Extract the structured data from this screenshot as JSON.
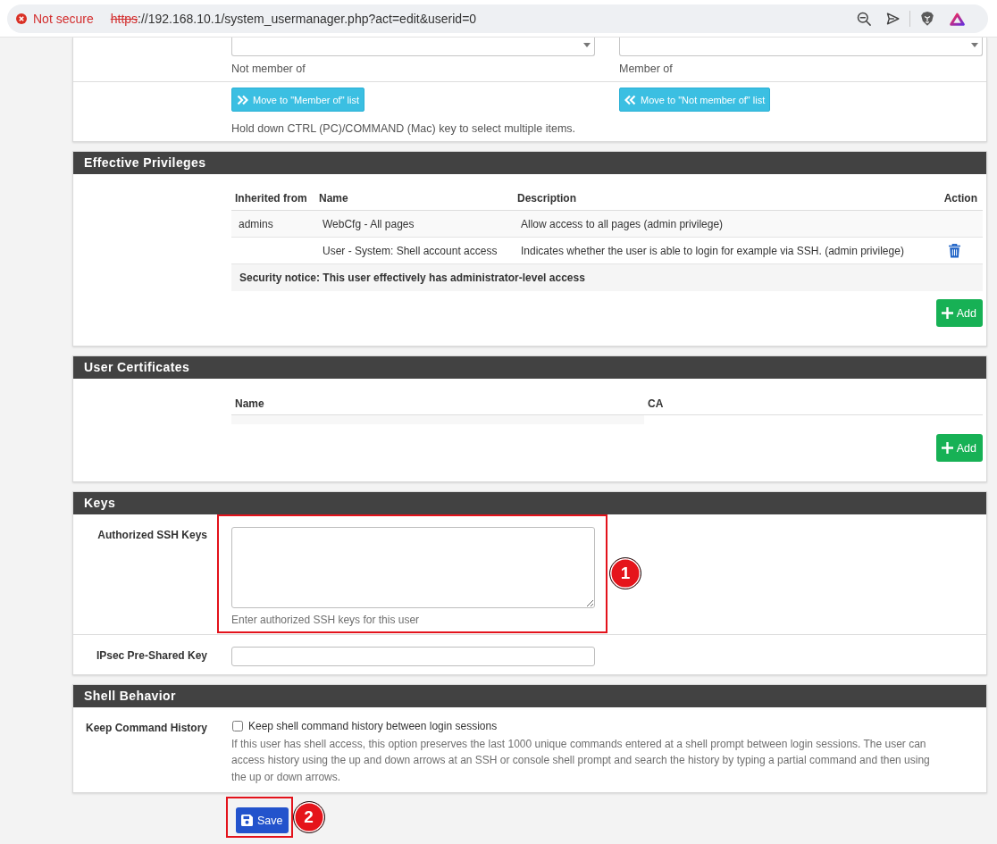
{
  "browser": {
    "secure": false,
    "security_label": "Not secure",
    "url_scheme": "https",
    "url_rest": "://192.168.10.1/system_usermanager.php?act=edit&userid=0"
  },
  "group_membership": {
    "lists": [
      {
        "label": "Not member of",
        "button": "Move to \"Member of\" list"
      },
      {
        "label": "Member of",
        "button": "Move to \"Not member of\" list"
      }
    ],
    "help": "Hold down CTRL (PC)/COMMAND (Mac) key to select multiple items."
  },
  "effective_privileges": {
    "title": "Effective Privileges",
    "columns": [
      "Inherited from",
      "Name",
      "Description",
      "Action"
    ],
    "rows": [
      {
        "inherited_from": "admins",
        "name": "WebCfg - All pages",
        "description": "Allow access to all pages (admin privilege)",
        "deletable": false
      },
      {
        "name": "User - System: Shell account access",
        "description": "Indicates whether the user is able to login for example via SSH. (admin privilege)",
        "deletable": true
      }
    ],
    "notice": "Security notice: This user effectively has administrator-level access",
    "add_button": "Add"
  },
  "user_certificates": {
    "title": "User Certificates",
    "columns": [
      "Name",
      "CA"
    ],
    "add_button": "Add"
  },
  "keys": {
    "title": "Keys",
    "fields": [
      {
        "kind": "textarea",
        "label": "Authorized SSH Keys",
        "help": "Enter authorized SSH keys for this user",
        "callout": "1"
      },
      {
        "kind": "input",
        "label": "IPsec Pre-Shared Key"
      }
    ]
  },
  "shell_behavior": {
    "title": "Shell Behavior",
    "fields": [
      {
        "kind": "checkbox",
        "label": "Keep Command History",
        "option": "Keep shell command history between login sessions",
        "checked": false,
        "help": "If this user has shell access, this option preserves the last 1000 unique commands entered at a shell prompt between login sessions. The user can access history using the up and down arrows at an SSH or console shell prompt and search the history by typing a partial command and then using the up or down arrows."
      }
    ]
  },
  "save_button": {
    "label": "Save",
    "callout": "2"
  }
}
